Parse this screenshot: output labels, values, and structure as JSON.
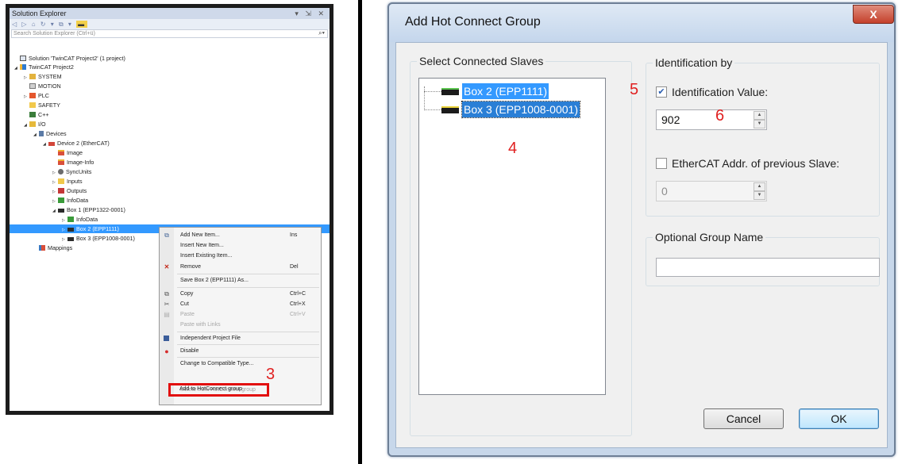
{
  "solution_explorer": {
    "title": "Solution Explorer",
    "window_buttons": "▾ ⇲ ✕",
    "toolbar_icons": "◁ ▷ ⌂ ↻ ▾ ⧉ ▾",
    "search_placeholder": "Search Solution Explorer (Ctrl+ü)",
    "tree": [
      {
        "label": "Solution 'TwinCAT Project2' (1 project)",
        "icon": "solution-icon"
      },
      {
        "label": "TwinCAT Project2",
        "icon": "project-icon"
      },
      {
        "label": "SYSTEM",
        "icon": "system-icon"
      },
      {
        "label": "MOTION",
        "icon": "motion-icon"
      },
      {
        "label": "PLC",
        "icon": "plc-icon"
      },
      {
        "label": "SAFETY",
        "icon": "safety-icon"
      },
      {
        "label": "C++",
        "icon": "cpp-icon"
      },
      {
        "label": "I/O",
        "icon": "io-icon"
      },
      {
        "label": "Devices",
        "icon": "devices-icon"
      },
      {
        "label": "Device 2 (EtherCAT)",
        "icon": "ethercat-device-icon"
      },
      {
        "label": "Image",
        "icon": "image-icon"
      },
      {
        "label": "Image-Info",
        "icon": "image-info-icon"
      },
      {
        "label": "SyncUnits",
        "icon": "syncunits-icon"
      },
      {
        "label": "Inputs",
        "icon": "inputs-icon"
      },
      {
        "label": "Outputs",
        "icon": "outputs-icon"
      },
      {
        "label": "InfoData",
        "icon": "infodata-icon"
      },
      {
        "label": "Box 1 (EPP1322-0001)",
        "icon": "box-icon"
      },
      {
        "label": "InfoData",
        "icon": "infodata-icon"
      },
      {
        "label": "Box 2 (EPP1111)",
        "icon": "box-icon",
        "selected": true
      },
      {
        "label": "Box 3 (EPP1008-0001)",
        "icon": "box-icon"
      },
      {
        "label": "Mappings",
        "icon": "mappings-icon"
      }
    ],
    "context_menu": [
      {
        "label": "Add New Item...",
        "shortcut": "Ins",
        "icon": "add-item-icon"
      },
      {
        "label": "Insert New Item...",
        "shortcut": ""
      },
      {
        "label": "Insert Existing Item...",
        "shortcut": ""
      },
      {
        "label": "Remove",
        "shortcut": "Del",
        "icon": "remove-icon"
      },
      {
        "label": "Save Box 2 (EPP1111) As...",
        "shortcut": ""
      },
      {
        "label": "Copy",
        "shortcut": "Ctrl+C",
        "icon": "copy-icon"
      },
      {
        "label": "Cut",
        "shortcut": "Ctrl+X",
        "icon": "cut-icon"
      },
      {
        "label": "Paste",
        "shortcut": "Ctrl+V",
        "icon": "paste-icon",
        "disabled": true
      },
      {
        "label": "Paste with Links",
        "shortcut": "",
        "disabled": true
      },
      {
        "label": "Independent Project File",
        "shortcut": "",
        "icon": "save-icon"
      },
      {
        "label": "Disable",
        "shortcut": "",
        "icon": "disable-icon"
      },
      {
        "label": "Change to Compatible Type...",
        "shortcut": ""
      },
      {
        "label": "Add to HotConnect group",
        "shortcut": "",
        "highlighted": true
      },
      {
        "label": "Delete from HotConnect group",
        "shortcut": "",
        "disabled": true
      }
    ]
  },
  "dialog": {
    "title": "Add Hot Connect Group",
    "close_label": "X",
    "slaves_group_label": "Select Connected Slaves",
    "slaves": [
      "Box 2 (EPP1111)",
      "Box 3 (EPP1008-0001)"
    ],
    "identification_group_label": "Identification by",
    "identification_value_label": "Identification Value:",
    "identification_value_checked": true,
    "identification_value": "902",
    "ethercat_addr_label": "EtherCAT Addr. of previous Slave:",
    "ethercat_addr_checked": false,
    "ethercat_addr_value": "0",
    "group_name_label": "Optional Group Name",
    "group_name_value": "",
    "cancel_label": "Cancel",
    "ok_label": "OK"
  },
  "step_markers": {
    "s3": "3",
    "s4": "4",
    "s5": "5",
    "s6": "6"
  },
  "colors": {
    "selection": "#3399ff",
    "highlight_border": "#e20e0e",
    "step_marker": "#e02020"
  }
}
